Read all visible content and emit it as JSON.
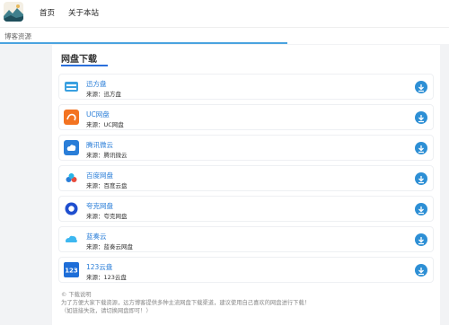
{
  "nav": {
    "items": [
      "首页",
      "关于本站"
    ]
  },
  "subbar": {
    "label": "博客资源"
  },
  "section": {
    "title": "网盘下载"
  },
  "downloads": [
    {
      "name": "迅方盘",
      "source": "来源：迅方盘",
      "icon": "xunfang-icon"
    },
    {
      "name": "UC网盘",
      "source": "来源：UC网盘",
      "icon": "uc-icon"
    },
    {
      "name": "腾讯微云",
      "source": "来源：腾讯微云",
      "icon": "weiyun-icon"
    },
    {
      "name": "百度网盘",
      "source": "来源：百度云盘",
      "icon": "baidu-icon"
    },
    {
      "name": "夸克网盘",
      "source": "来源：夸克网盘",
      "icon": "quark-icon"
    },
    {
      "name": "蓝奏云",
      "source": "来源：蓝奏云网盘",
      "icon": "lanzou-icon"
    },
    {
      "name": "123云盘",
      "source": "来源：123云盘",
      "icon": "123pan-icon"
    }
  ],
  "footer": {
    "heading": "下载说明",
    "line1": "为了方便大家下载资源，远方博客提供多种主流网盘下载渠道，建议使用自己喜欢的网盘进行下载！",
    "line2": "（如链接失效，请切换网盘即可！）"
  },
  "colors": {
    "accent": "#2a7ed8",
    "download_button": "#2d8fd5",
    "progress": "#4aa3df"
  }
}
